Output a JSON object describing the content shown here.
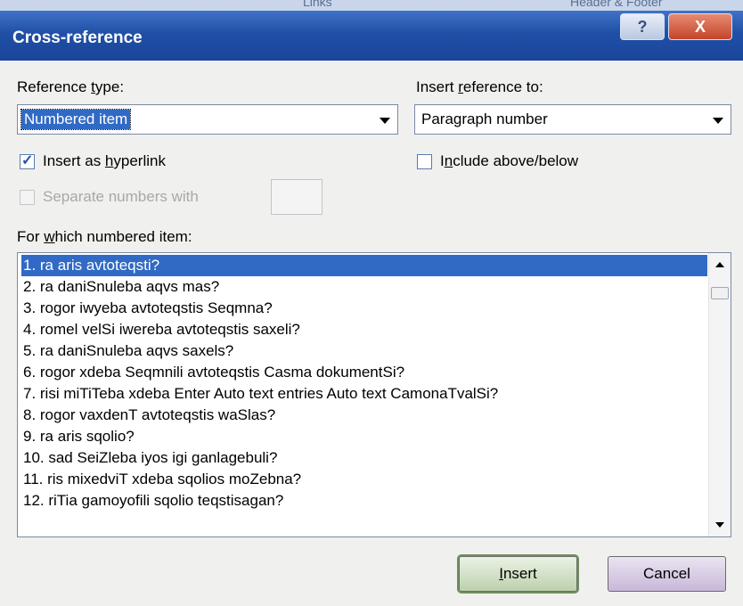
{
  "window": {
    "title": "Cross-reference",
    "help_glyph": "?",
    "close_glyph": "X"
  },
  "top_strip": {
    "left_tab": "Links",
    "right_tab": "Header & Footer"
  },
  "reference_type": {
    "label_pre": "Reference ",
    "label_u": "t",
    "label_post": "ype:",
    "value": "Numbered item"
  },
  "insert_reference_to": {
    "label_pre": "Insert ",
    "label_u": "r",
    "label_post": "eference to:",
    "value": "Paragraph number"
  },
  "insert_as_hyperlink": {
    "label_pre": "Insert as ",
    "label_u": "h",
    "label_post": "yperlink",
    "checked": true,
    "check_glyph": "✓"
  },
  "include_above_below": {
    "label_pre": "I",
    "label_u": "n",
    "label_post": "clude above/below",
    "checked": false
  },
  "separate_numbers": {
    "label": "Separate numbers with",
    "enabled": false
  },
  "items_label": {
    "pre": "For ",
    "u": "w",
    "post": "hich numbered item:"
  },
  "items": [
    "1. ra aris avtoteqsti?",
    "2. ra daniSnuleba aqvs mas?",
    "3. rogor iwyeba avtoteqstis Seqmna?",
    "4. romel velSi iwereba avtoteqstis saxeli?",
    "5. ra daniSnuleba aqvs saxels?",
    "6. rogor xdeba Seqmnili avtoteqstis Casma dokumentSi?",
    "7. risi miTiTeba xdeba Enter Auto text entries Auto text  CamonaTvalSi?",
    "8. rogor vaxdenT avtoteqstis waSlas?",
    "9. ra aris sqolio?",
    "10. sad SeiZleba iyos igi ganlagebuli?",
    "11. ris mixedviT xdeba sqolios moZebna?",
    "12. riTia gamoyofili sqolio teqstisagan?"
  ],
  "buttons": {
    "insert": {
      "u": "I",
      "post": "nsert"
    },
    "cancel": "Cancel"
  },
  "colors": {
    "title_bar": "#1f4fa6",
    "selection": "#316ac5",
    "dialog_bg": "#f0f0ee"
  }
}
